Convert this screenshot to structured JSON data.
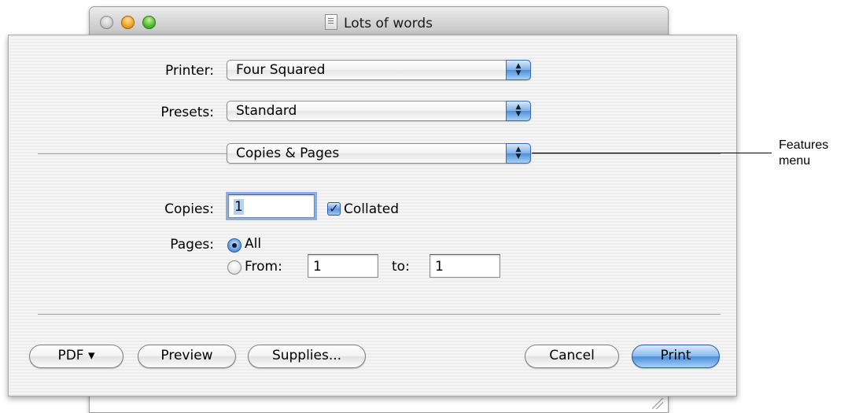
{
  "window": {
    "title": "Lots of words"
  },
  "sheet": {
    "printer": {
      "label": "Printer:",
      "value": "Four Squared"
    },
    "presets": {
      "label": "Presets:",
      "value": "Standard"
    },
    "features": {
      "value": "Copies & Pages"
    },
    "copies": {
      "label": "Copies:",
      "value": "1",
      "collated_label": "Collated",
      "collated_checked": true
    },
    "pages": {
      "label": "Pages:",
      "all_label": "All",
      "from_label": "From:",
      "from_value": "1",
      "to_label": "to:",
      "to_value": "1",
      "selected": "All"
    },
    "buttons": {
      "pdf": "PDF ▾",
      "preview": "Preview",
      "supplies": "Supplies...",
      "cancel": "Cancel",
      "print": "Print"
    }
  },
  "callout": {
    "line1": "Features",
    "line2": "menu"
  },
  "icons": [
    "document-icon",
    "popup-arrows-icon",
    "checkmark-icon",
    "resize-grip-icon"
  ],
  "colors": {
    "accent": "#5f9ae0",
    "sheet_bg": "#f0f0f0"
  }
}
